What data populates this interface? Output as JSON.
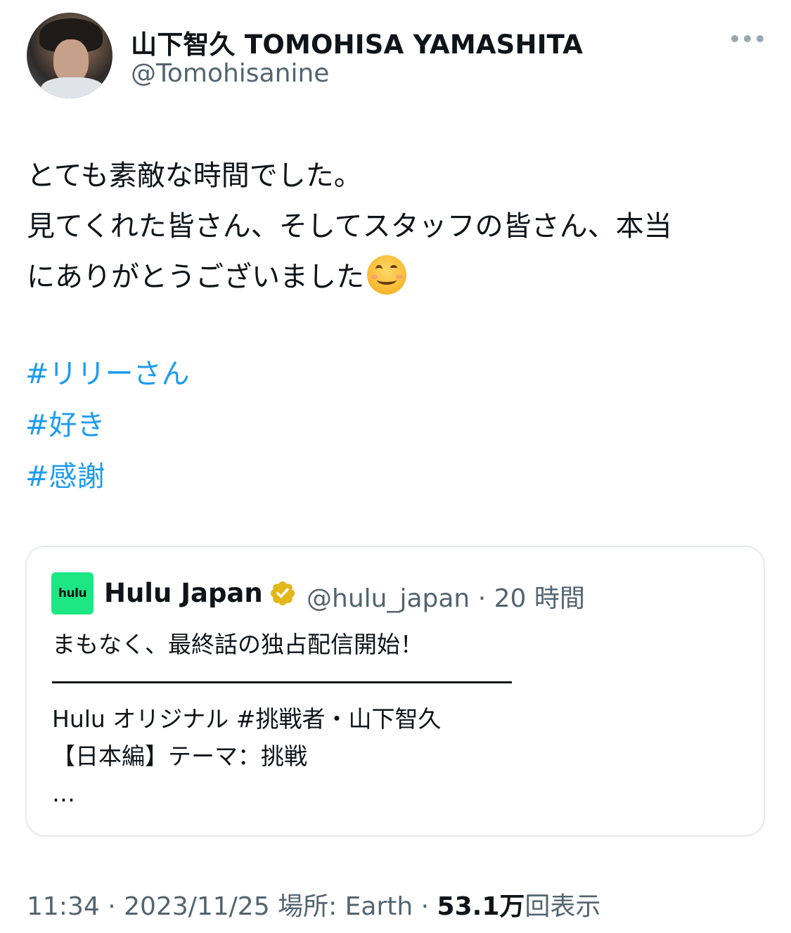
{
  "author": {
    "display_name": "山下智久 TOMOHISA YAMASHITA",
    "handle": "@Tomohisanine",
    "avatar_icon": "profile-photo"
  },
  "tweet": {
    "lines": [
      "とても素敵な時間でした。",
      "見てくれた皆さん、そしてスタッフの皆さん、本当",
      "にありがとうございました"
    ],
    "emoji": "smiling-face-emoji",
    "hashtags": [
      "#リリーさん",
      "#好き",
      "#感謝"
    ]
  },
  "quoted_tweet": {
    "logo_text": "hulu",
    "name": "Hulu Japan",
    "verified_icon": "verified-badge-gold",
    "handle": "@hulu_japan",
    "separator": "·",
    "time": "20 時間",
    "line1": "まもなく、最終話の独占配信開始！",
    "line2": "Hulu オリジナル #挑戦者・山下智久",
    "line3": "【日本編】テーマ：挑戦",
    "line4": "…"
  },
  "meta": {
    "time": "11:34",
    "sep1": "·",
    "date": "2023/11/25",
    "location": "場所: Earth",
    "sep2": "·",
    "views_count": "53.1万",
    "views_label": "回表示"
  },
  "colors": {
    "link": "#1d9bf0",
    "secondary_text": "#536471",
    "hulu_green": "#1ce783",
    "verified_gold": "#e2b719"
  }
}
